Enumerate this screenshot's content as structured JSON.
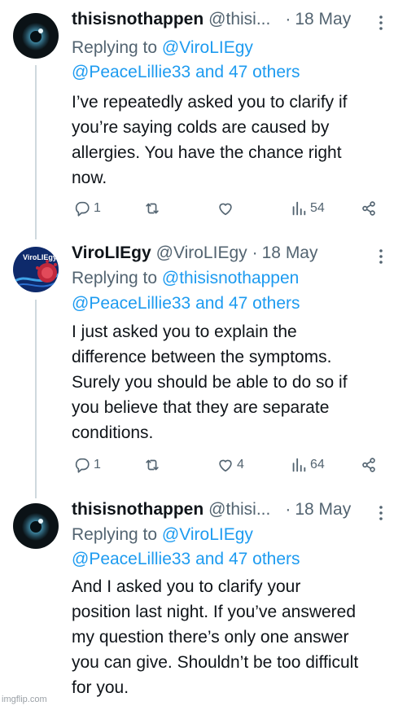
{
  "tweets": [
    {
      "name": "thisisnothappen",
      "handle": "@thisi...",
      "time": "18 May",
      "replying_prefix": "Replying to ",
      "replying_to": "@ViroLIEgy",
      "replying_others": "@PeaceLillie33 and 47 others",
      "text_lines": [
        "I’ve repeatedly asked you to clarify if",
        "you’re saying colds are caused by",
        "allergies. You have the chance right",
        "now."
      ],
      "replies": "1",
      "retweets": "",
      "likes": "",
      "views": "54"
    },
    {
      "name": "ViroLIEgy",
      "handle": "@ViroLIEgy",
      "time": "18 May",
      "replying_prefix": "Replying to ",
      "replying_to": "@thisisnothappen",
      "replying_others": "@PeaceLillie33 and 47 others",
      "text_lines": [
        "I just asked you to explain the",
        "difference between the symptoms.",
        "Surely you should be able to do so if",
        "you believe that they are separate",
        "conditions."
      ],
      "replies": "1",
      "retweets": "",
      "likes": "4",
      "views": "64",
      "avatar_text": "ViroLIEgy"
    },
    {
      "name": "thisisnothappen",
      "handle": "@thisi...",
      "time": "18 May",
      "replying_prefix": "Replying to ",
      "replying_to": "@ViroLIEgy",
      "replying_others": "@PeaceLillie33 and 47 others",
      "text_lines": [
        "And I asked you to clarify your",
        "position last night. If you’ve answered",
        "my question there’s only one answer",
        "you can give. Shouldn’t be too difficult",
        "for you."
      ]
    }
  ],
  "dot_separator": "·",
  "watermark": "imgflip.com",
  "colors": {
    "link": "#1d9bf0",
    "secondary": "#536471",
    "text": "#0f1419",
    "thread_line": "#cfd9de"
  }
}
